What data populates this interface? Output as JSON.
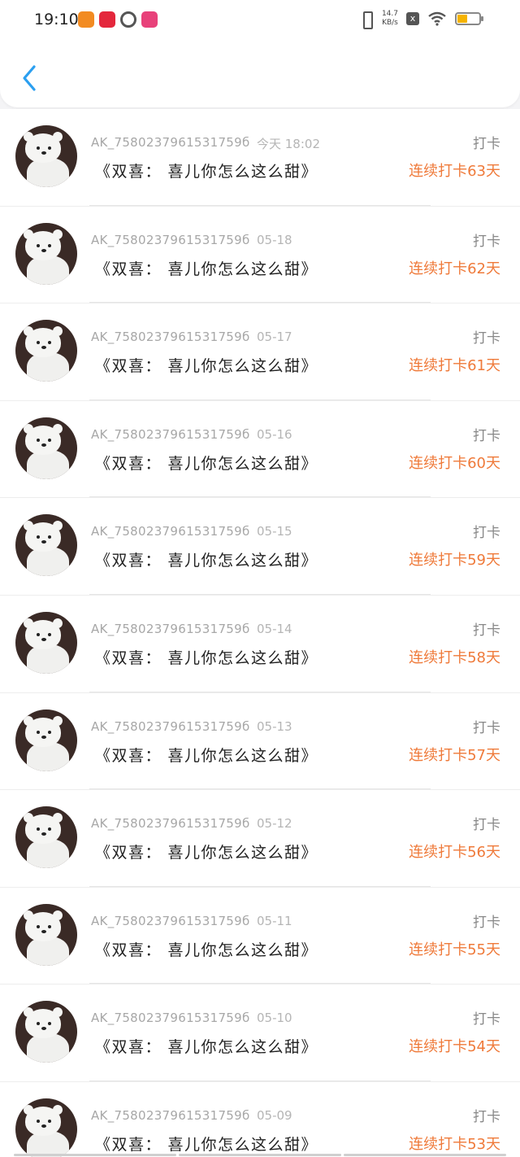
{
  "status_bar": {
    "time": "19:10",
    "net_speed_value": "14.7",
    "net_speed_unit": "KB/s",
    "x_label": "x",
    "battery_color": "#f5b300",
    "app_icons": [
      "orange-app-icon",
      "red-app-icon",
      "ring-app-icon",
      "pink-app-icon"
    ]
  },
  "nav": {
    "back_icon": "chevron-left-icon",
    "accent_color": "#2b9ff0"
  },
  "list": {
    "checkin_label": "打卡",
    "book_title": "《双喜： 喜儿你怎么这么甜》",
    "user_id": "AK_7580237961531759б",
    "streak_color": "#ef7a3a",
    "items": [
      {
        "user_id": "AK_7580237961531759б",
        "date": "今天 18:02",
        "title": "《双喜： 喜儿你怎么这么甜》",
        "tag": "打卡",
        "streak": "连续打卡63天"
      },
      {
        "user_id": "AK_7580237961531759б",
        "date": "05-18",
        "title": "《双喜： 喜儿你怎么这么甜》",
        "tag": "打卡",
        "streak": "连续打卡62天"
      },
      {
        "user_id": "AK_7580237961531759б",
        "date": "05-17",
        "title": "《双喜： 喜儿你怎么这么甜》",
        "tag": "打卡",
        "streak": "连续打卡61天"
      },
      {
        "user_id": "AK_7580237961531759б",
        "date": "05-16",
        "title": "《双喜： 喜儿你怎么这么甜》",
        "tag": "打卡",
        "streak": "连续打卡60天"
      },
      {
        "user_id": "AK_7580237961531759б",
        "date": "05-15",
        "title": "《双喜： 喜儿你怎么这么甜》",
        "tag": "打卡",
        "streak": "连续打卡59天"
      },
      {
        "user_id": "AK_7580237961531759б",
        "date": "05-14",
        "title": "《双喜： 喜儿你怎么这么甜》",
        "tag": "打卡",
        "streak": "连续打卡58天"
      },
      {
        "user_id": "AK_7580237961531759б",
        "date": "05-13",
        "title": "《双喜： 喜儿你怎么这么甜》",
        "tag": "打卡",
        "streak": "连续打卡57天"
      },
      {
        "user_id": "AK_7580237961531759б",
        "date": "05-12",
        "title": "《双喜： 喜儿你怎么这么甜》",
        "tag": "打卡",
        "streak": "连续打卡56天"
      },
      {
        "user_id": "AK_7580237961531759б",
        "date": "05-11",
        "title": "《双喜： 喜儿你怎么这么甜》",
        "tag": "打卡",
        "streak": "连续打卡55天"
      },
      {
        "user_id": "AK_7580237961531759б",
        "date": "05-10",
        "title": "《双喜： 喜儿你怎么这么甜》",
        "tag": "打卡",
        "streak": "连续打卡54天"
      },
      {
        "user_id": "AK_7580237961531759б",
        "date": "05-09",
        "title": "《双喜： 喜儿你怎么这么甜》",
        "tag": "打卡",
        "streak": "连续打卡53天"
      }
    ]
  }
}
